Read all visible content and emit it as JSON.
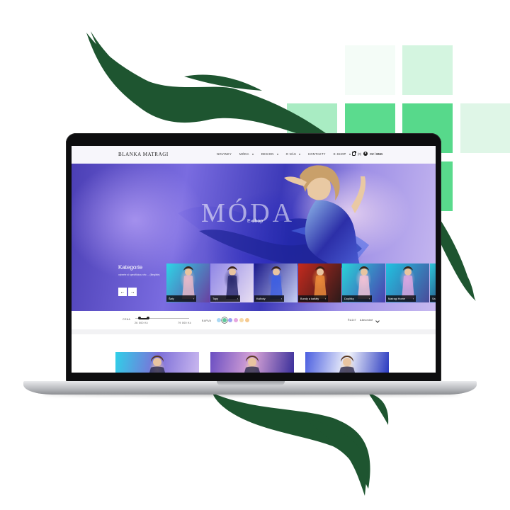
{
  "site": {
    "logo": "BLANKA MATRAGI",
    "nav": [
      {
        "label": "NOVINKY",
        "dropdown": false
      },
      {
        "label": "MÓDA",
        "dropdown": true
      },
      {
        "label": "DESIGN",
        "dropdown": true
      },
      {
        "label": "O NÁS",
        "dropdown": true
      },
      {
        "label": "KONTAKTY",
        "dropdown": false
      },
      {
        "label": "E-SHOP",
        "dropdown": true
      }
    ],
    "cart_count": "(0)",
    "language": "CZ / ENG"
  },
  "hero": {
    "title": "MÓDA",
    "subtitle": "E-shop",
    "categories_title": "Kategorie",
    "categories_desc": "vyberte si specifickou věc ... (illegible)",
    "prev_symbol": "←",
    "next_symbol": "→",
    "categories": [
      {
        "label": "Šaty",
        "arrow": "›",
        "palette": [
          "#2dd4e6",
          "#e6b8c8",
          "#6a3fa0"
        ]
      },
      {
        "label": "Topy",
        "arrow": "›",
        "palette": [
          "#8f86e6",
          "#2a2a6e",
          "#e9dff2"
        ]
      },
      {
        "label": "Kalhoty",
        "arrow": "›",
        "palette": [
          "#1b1a8a",
          "#3e5fe0",
          "#c8d0f5"
        ]
      },
      {
        "label": "Bundy a kabáty",
        "arrow": "›",
        "palette": [
          "#c42a1e",
          "#e98a3a",
          "#2a1a1a"
        ]
      },
      {
        "label": "Doplňky",
        "arrow": "›",
        "palette": [
          "#29d3d8",
          "#f1c1d5",
          "#4a3fb0"
        ]
      },
      {
        "label": "Matragi Home",
        "arrow": "›",
        "palette": [
          "#20c2e0",
          "#d8a6e0",
          "#4a4a9a"
        ]
      },
      {
        "label": "Sa",
        "arrow": "",
        "palette": [
          "#2bc6d8",
          "#6b7bd8",
          "#2a2a6a"
        ]
      }
    ]
  },
  "filters": {
    "price_label": "CENA",
    "price_min": "26 000 Kč",
    "price_max": "79 000 Kč",
    "color_label": "BARVA",
    "colors": [
      "#a9d9f5",
      "#5ec79a",
      "#9ea2f3",
      "#e6a7e0",
      "#f6d9a6",
      "#f6c98f"
    ],
    "sort_label": "ŘADIT",
    "sort_value": "Abecedně"
  },
  "products": [
    {
      "palette": [
        "#2fd0e8",
        "#7d6fd8",
        "#c9b7ef"
      ]
    },
    {
      "palette": [
        "#6b4fc2",
        "#d7a3d6",
        "#3a2f9a"
      ]
    },
    {
      "palette": [
        "#4b5fe0",
        "#f2f4fb",
        "#2a3ac0"
      ]
    }
  ],
  "decor": {
    "brush_color": "#1f5a33",
    "tile_colors": [
      "#f2fbf5",
      "#dff6e7",
      "#bff0d1",
      "#5bdb8e"
    ]
  }
}
